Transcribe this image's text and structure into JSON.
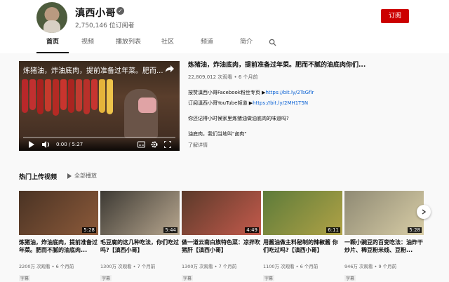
{
  "channel": {
    "name": "滇西小哥",
    "subscribers": "2,750,146 位订阅者",
    "subscribe_label": "订阅"
  },
  "tabs": [
    {
      "label": "首页"
    },
    {
      "label": "视频"
    },
    {
      "label": "播放列表"
    },
    {
      "label": "社区"
    },
    {
      "label": "频道"
    },
    {
      "label": "简介"
    }
  ],
  "featured": {
    "overlay_title": "炼猪油，炸油底肉，提前准备过年菜。肥而...",
    "time": "0:00 / 5:27",
    "progress": 0,
    "title": "炼猪油，炸油底肉，提前准备过年菜。肥而不腻的油底肉你们...",
    "meta": "22,809,012 次观看 • 6 个月前",
    "line1_text": "按赞滇西小哥Facebook粉丝专页 ▶",
    "line1_link": "https://bit.ly/2TsGflr",
    "line2_text": "订阅滇西小哥YouTube频道 ▶",
    "line2_link": "https://bit.ly/2MH1T5N",
    "line3": "你还记得小时候家里炼猪油做油底肉的味道吗?",
    "line4": "油底肉，我们当地叫\"卤肉\"",
    "more": "了解详情"
  },
  "popular": {
    "title": "热门上传视频",
    "play_all": "全部播放",
    "videos": [
      {
        "title": "炼猪油，炸油底肉，提前准备过年菜。肥而不腻的油底肉...",
        "meta": "2200万 次观看 • 6 个月前",
        "duration": "5:28",
        "badge": "字幕",
        "colors": [
          "#4a3324",
          "#8c5a3a"
        ]
      },
      {
        "title": "毛豆腐的这几种吃法，你们吃过吗?【滇西小哥】",
        "meta": "1300万 次观看 • 7 个月前",
        "duration": "5:44",
        "badge": "字幕",
        "colors": [
          "#3d3a34",
          "#b7a68e"
        ]
      },
      {
        "title": "做一道云南白族特色菜：凉拌吹猪肝【滇西小哥】",
        "meta": "1300万 次观看 • 7 个月前",
        "duration": "4:49",
        "badge": "字幕",
        "colors": [
          "#5b3a2a",
          "#c45a4c"
        ]
      },
      {
        "title": "用酱油做主料秘制的辣椒酱 你们吃过吗?【滇西小哥】",
        "meta": "1100万 次观看 • 6 个月前",
        "duration": "6:11",
        "badge": "字幕",
        "colors": [
          "#5d7b3a",
          "#b0a246"
        ]
      },
      {
        "title": "一颗小豌豆的百变吃法：油炸干炒片、稀豆粉米线、豆粉...",
        "meta": "946万 次观看 • 9 个月前",
        "duration": "5:28",
        "badge": "字幕",
        "colors": [
          "#8f8a74",
          "#d8cda6"
        ]
      }
    ]
  }
}
